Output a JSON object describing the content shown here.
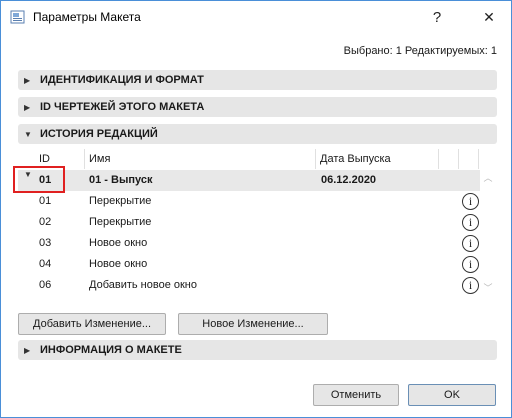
{
  "window": {
    "title": "Параметры Макета",
    "help_label": "?",
    "close_label": "✕"
  },
  "selection_info": "Выбрано: 1 Редактируемых: 1",
  "sections": {
    "identification": "ИДЕНТИФИКАЦИЯ И ФОРМАТ",
    "drawing_ids": "ID ЧЕРТЕЖЕЙ ЭТОГО МАКЕТА",
    "revision_history": "ИСТОРИЯ РЕДАКЦИЙ",
    "layout_info": "ИНФОРМАЦИЯ О МАКЕТЕ"
  },
  "table": {
    "columns": [
      "ID",
      "Имя",
      "Дата Выпуска"
    ],
    "issue_row": {
      "id": "01",
      "name": "01 - Выпуск",
      "date": "06.12.2020"
    },
    "changes": [
      {
        "id": "01",
        "name": "Перекрытие"
      },
      {
        "id": "02",
        "name": "Перекрытие"
      },
      {
        "id": "03",
        "name": "Новое окно"
      },
      {
        "id": "04",
        "name": "Новое окно"
      },
      {
        "id": "06",
        "name": "Добавить новое окно"
      }
    ],
    "info_icon_glyph": "i"
  },
  "buttons": {
    "add_change": "Добавить Изменение...",
    "new_change": "Новое Изменение...",
    "cancel": "Отменить",
    "ok": "OK"
  },
  "icons": {
    "app": "layout-settings-icon",
    "expanded": "triangle-down-icon",
    "collapsed": "triangle-right-icon",
    "info": "info-circle-icon"
  },
  "colors": {
    "highlight_box": "#e02020",
    "window_border": "#4a8fd8",
    "section_bg": "#e6e6e6"
  }
}
